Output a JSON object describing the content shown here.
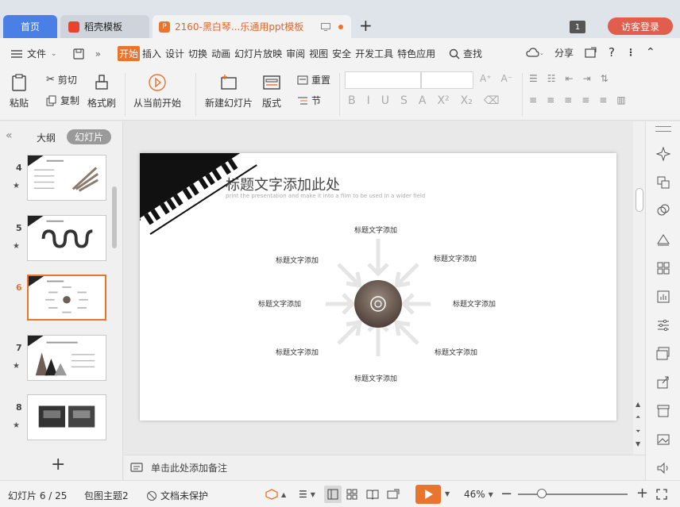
{
  "titlebar": {
    "tabs": [
      {
        "label": "首页"
      },
      {
        "label": "稻壳模板"
      },
      {
        "label": "2160-黑白琴...乐通用ppt模板"
      }
    ],
    "window_count": "1",
    "login_label": "访客登录"
  },
  "menubar": {
    "file_label": "文件",
    "items": [
      "开始",
      "插入",
      "设计",
      "切换",
      "动画",
      "幻灯片放映",
      "审阅",
      "视图",
      "安全",
      "开发工具",
      "特色应用"
    ],
    "active_item": "开始",
    "search_label": "查找",
    "share_label": "分享"
  },
  "ribbon": {
    "paste": "粘贴",
    "cut": "剪切",
    "copy": "复制",
    "format_painter": "格式刷",
    "play_from_current": "从当前开始",
    "new_slide": "新建幻灯片",
    "layout": "版式",
    "reset": "重置",
    "section": "节",
    "font_buttons": [
      "B",
      "I",
      "U",
      "S",
      "A",
      "X²",
      "X₂"
    ]
  },
  "left_panel": {
    "tab_outline": "大纲",
    "tab_slides": "幻灯片",
    "thumbnails": [
      {
        "num": "4"
      },
      {
        "num": "5"
      },
      {
        "num": "6"
      },
      {
        "num": "7"
      },
      {
        "num": "8"
      }
    ],
    "active_slide": "6"
  },
  "slide": {
    "title": "标题文字添加此处",
    "subtitle": "print the presentation and make it into a film to be used in a wider field",
    "labels": [
      "标题文字添加",
      "标题文字添加",
      "标题文字添加",
      "标题文字添加",
      "标题文字添加",
      "标题文字添加",
      "标题文字添加",
      "标题文字添加"
    ]
  },
  "notes": {
    "placeholder": "单击此处添加备注"
  },
  "statusbar": {
    "slide_counter": "幻灯片 6 / 25",
    "theme": "包图主题2",
    "protection": "文档未保护",
    "zoom": "46%"
  },
  "colors": {
    "accent": "#e8742d",
    "home_tab": "#4a7fe6",
    "login": "#e35d4d"
  }
}
